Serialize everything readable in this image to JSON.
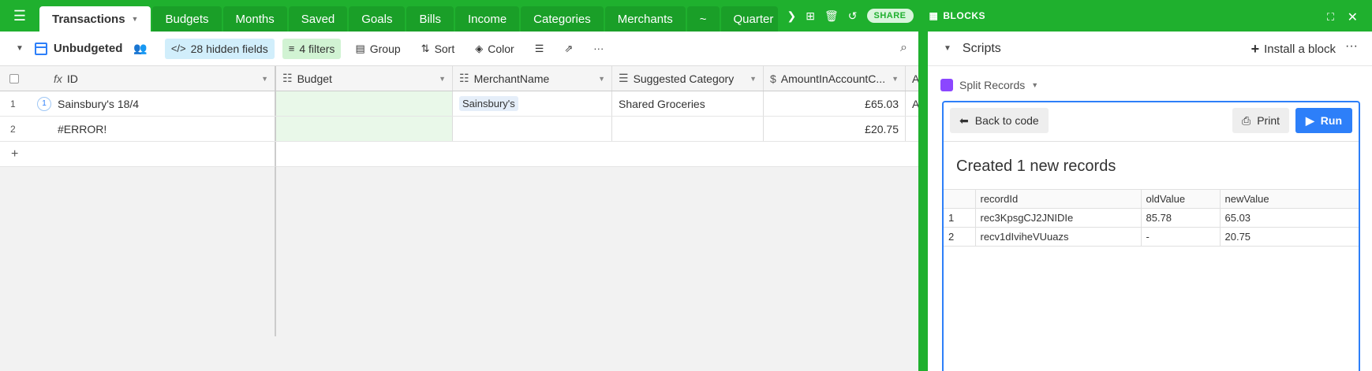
{
  "top": {
    "tabs": [
      "Transactions",
      "Budgets",
      "Months",
      "Saved",
      "Goals",
      "Bills",
      "Income",
      "Categories",
      "Merchants",
      "~",
      "Quarter"
    ],
    "share_label": "SHARE",
    "blocks_label": "BLOCKS"
  },
  "toolbar": {
    "view_name": "Unbudgeted",
    "hidden_fields": "28 hidden fields",
    "filters": "4 filters",
    "group": "Group",
    "sort": "Sort",
    "color": "Color"
  },
  "grid": {
    "columns": [
      "ID",
      "Budget",
      "MerchantName",
      "Suggested Category",
      "AmountInAccountC...",
      "A"
    ],
    "rows": [
      {
        "num": "1",
        "badge": "1",
        "id": "Sainsbury's 18/4",
        "budget": "",
        "merchant": "Sainsbury's",
        "category": "Shared Groceries",
        "amount": "£65.03",
        "more": "Ap"
      },
      {
        "num": "2",
        "badge": "",
        "id": "#ERROR!",
        "budget": "",
        "merchant": "",
        "category": "",
        "amount": "£20.75",
        "more": ""
      }
    ],
    "add_label": "+"
  },
  "panel": {
    "title": "Scripts",
    "install_label": "Install a block",
    "block_name": "Split Records",
    "back_label": "Back to code",
    "print_label": "Print",
    "run_label": "Run",
    "output_title": "Created 1 new records",
    "table": {
      "headers": [
        "",
        "recordId",
        "oldValue",
        "newValue"
      ],
      "rows": [
        [
          "1",
          "rec3KpsgCJ2JNIDIe",
          "85.78",
          "65.03"
        ],
        [
          "2",
          "recv1dIviheVUuazs",
          "-",
          "20.75"
        ]
      ]
    }
  }
}
